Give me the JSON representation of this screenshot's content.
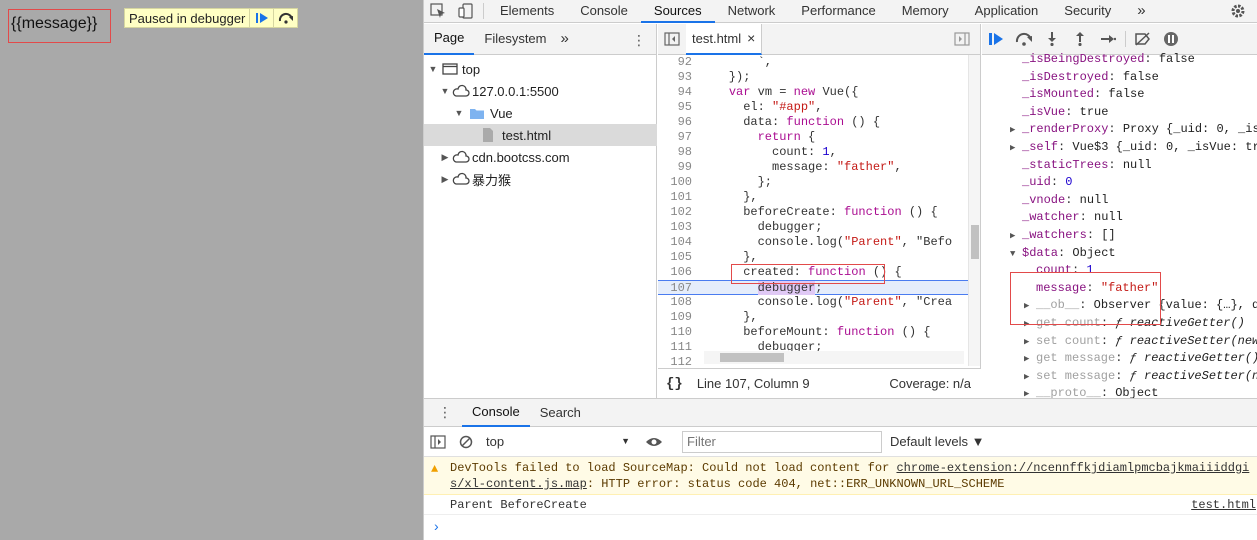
{
  "page": {
    "message_text": "{{message}}",
    "paused_text": "Paused in debugger"
  },
  "devtools": {
    "main_tabs": [
      "Elements",
      "Console",
      "Sources",
      "Network",
      "Performance",
      "Memory",
      "Application",
      "Security"
    ],
    "more_tabs": "»",
    "navigator": {
      "tabs": [
        "Page",
        "Filesystem"
      ],
      "more": "»",
      "tree": [
        "top",
        "127.0.0.1:5500",
        "Vue",
        "test.html",
        "cdn.bootcss.com",
        "暴力猴"
      ]
    },
    "editor": {
      "file_tab": "test.html",
      "close": "×",
      "status_position": "Line 107, Column 9",
      "status_coverage": "Coverage: n/a",
      "pretty_print": "{}",
      "lines": [
        {
          "n": "92",
          "t": "        `,"
        },
        {
          "n": "93",
          "t": "    });"
        },
        {
          "n": "94",
          "t": "    var vm = new Vue({"
        },
        {
          "n": "95",
          "t": "      el: \"#app\","
        },
        {
          "n": "96",
          "t": "      data: function () {"
        },
        {
          "n": "97",
          "t": "        return {"
        },
        {
          "n": "98",
          "t": "          count: 1,"
        },
        {
          "n": "99",
          "t": "          message: \"father\","
        },
        {
          "n": "100",
          "t": "        };"
        },
        {
          "n": "101",
          "t": "      },"
        },
        {
          "n": "102",
          "t": "      beforeCreate: function () {"
        },
        {
          "n": "103",
          "t": "        debugger;"
        },
        {
          "n": "104",
          "t": "        console.log(\"Parent\", \"Befo"
        },
        {
          "n": "105",
          "t": "      },"
        },
        {
          "n": "106",
          "t": "      created: function () {"
        },
        {
          "n": "107",
          "t": "        debugger;"
        },
        {
          "n": "108",
          "t": "        console.log(\"Parent\", \"Crea"
        },
        {
          "n": "109",
          "t": "      },"
        },
        {
          "n": "110",
          "t": "      beforeMount: function () {"
        },
        {
          "n": "111",
          "t": "        debugger;"
        },
        {
          "n": "112",
          "t": ""
        }
      ]
    },
    "scope": {
      "lines": [
        {
          "k": "_isBeingDestroyed",
          "v": "false",
          "vt": "v",
          "indent": 0,
          "arrow": ""
        },
        {
          "k": "_isDestroyed",
          "v": "false",
          "vt": "v",
          "indent": 0,
          "arrow": ""
        },
        {
          "k": "_isMounted",
          "v": "false",
          "vt": "v",
          "indent": 0,
          "arrow": ""
        },
        {
          "k": "_isVue",
          "v": "true",
          "vt": "v",
          "indent": 0,
          "arrow": ""
        },
        {
          "k": "_renderProxy",
          "v": "Proxy {_uid: 0, _is",
          "vt": "v",
          "indent": 0,
          "arrow": "▶"
        },
        {
          "k": "_self",
          "v": "Vue$3 {_uid: 0, _isVue: tr",
          "vt": "v",
          "indent": 0,
          "arrow": "▶"
        },
        {
          "k": "_staticTrees",
          "v": "null",
          "vt": "v",
          "indent": 0,
          "arrow": ""
        },
        {
          "k": "_uid",
          "v": "0",
          "vt": "vn",
          "indent": 0,
          "arrow": ""
        },
        {
          "k": "_vnode",
          "v": "null",
          "vt": "v",
          "indent": 0,
          "arrow": ""
        },
        {
          "k": "_watcher",
          "v": "null",
          "vt": "v",
          "indent": 0,
          "arrow": ""
        },
        {
          "k": "_watchers",
          "v": "[]",
          "vt": "v",
          "indent": 0,
          "arrow": "▶"
        },
        {
          "k": "$data",
          "v": "Object",
          "vt": "v",
          "indent": 0,
          "arrow": "▼"
        },
        {
          "k": "count",
          "v": "1",
          "vt": "vn",
          "indent": 1,
          "arrow": ""
        },
        {
          "k": "message",
          "v": "\"father\"",
          "vt": "vs",
          "indent": 1,
          "arrow": ""
        },
        {
          "k": "__ob__",
          "v": "Observer {value: {…}, d",
          "vt": "v",
          "indent": 1,
          "arrow": "▶"
        },
        {
          "k": "get count",
          "v": "ƒ reactiveGetter()",
          "vt": "it",
          "indent": 1,
          "arrow": "▶"
        },
        {
          "k": "set count",
          "v": "ƒ reactiveSetter(new",
          "vt": "it",
          "indent": 1,
          "arrow": "▶"
        },
        {
          "k": "get message",
          "v": "ƒ reactiveGetter()",
          "vt": "it",
          "indent": 1,
          "arrow": "▶"
        },
        {
          "k": "set message",
          "v": "ƒ reactiveSetter(n",
          "vt": "it",
          "indent": 1,
          "arrow": "▶"
        },
        {
          "k": "__proto__",
          "v": "Object",
          "vt": "v",
          "indent": 1,
          "arrow": "▶"
        }
      ]
    },
    "drawer": {
      "tabs": [
        "Console",
        "Search"
      ],
      "context": "top",
      "filter_placeholder": "Filter",
      "levels": "Default levels ▼",
      "warning_line1_prefix": "DevTools failed to load SourceMap: Could not load content for ",
      "warning_link1": "chrome-extension://ncennffkjdiamlpmcbajkmaiiiddgi",
      "warning_link2": "s/xl-content.js.map",
      "warning_line2_suffix": ": HTTP error: status code 404, net::ERR_UNKNOWN_URL_SCHEME",
      "log_text": "Parent BeforeCreate",
      "log_source": "test.html",
      "prompt": "›"
    }
  }
}
